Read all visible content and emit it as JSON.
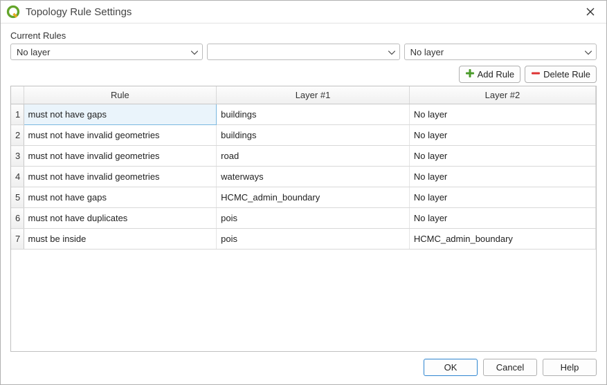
{
  "window": {
    "title": "Topology Rule Settings"
  },
  "section_label": "Current Rules",
  "selects": {
    "layer1": "No layer",
    "rule": "",
    "layer2": "No layer"
  },
  "buttons": {
    "add_rule": "Add Rule",
    "delete_rule": "Delete Rule"
  },
  "table": {
    "headers": {
      "rule": "Rule",
      "layer1": "Layer #1",
      "layer2": "Layer #2"
    },
    "rows": [
      {
        "n": "1",
        "rule": "must not have gaps",
        "layer1": "buildings",
        "layer2": "No layer",
        "selected": true
      },
      {
        "n": "2",
        "rule": "must not have invalid geometries",
        "layer1": "buildings",
        "layer2": "No layer"
      },
      {
        "n": "3",
        "rule": "must not have invalid geometries",
        "layer1": "road",
        "layer2": "No layer"
      },
      {
        "n": "4",
        "rule": "must not have invalid geometries",
        "layer1": "waterways",
        "layer2": "No layer"
      },
      {
        "n": "5",
        "rule": "must not have gaps",
        "layer1": "HCMC_admin_boundary",
        "layer2": "No layer"
      },
      {
        "n": "6",
        "rule": "must not have duplicates",
        "layer1": "pois",
        "layer2": "No layer"
      },
      {
        "n": "7",
        "rule": "must be inside",
        "layer1": "pois",
        "layer2": "HCMC_admin_boundary"
      }
    ]
  },
  "footer": {
    "ok": "OK",
    "cancel": "Cancel",
    "help": "Help"
  },
  "icons": {
    "add": "plus-icon",
    "delete": "minus-icon",
    "close": "close-icon",
    "logo": "qgis-logo"
  }
}
